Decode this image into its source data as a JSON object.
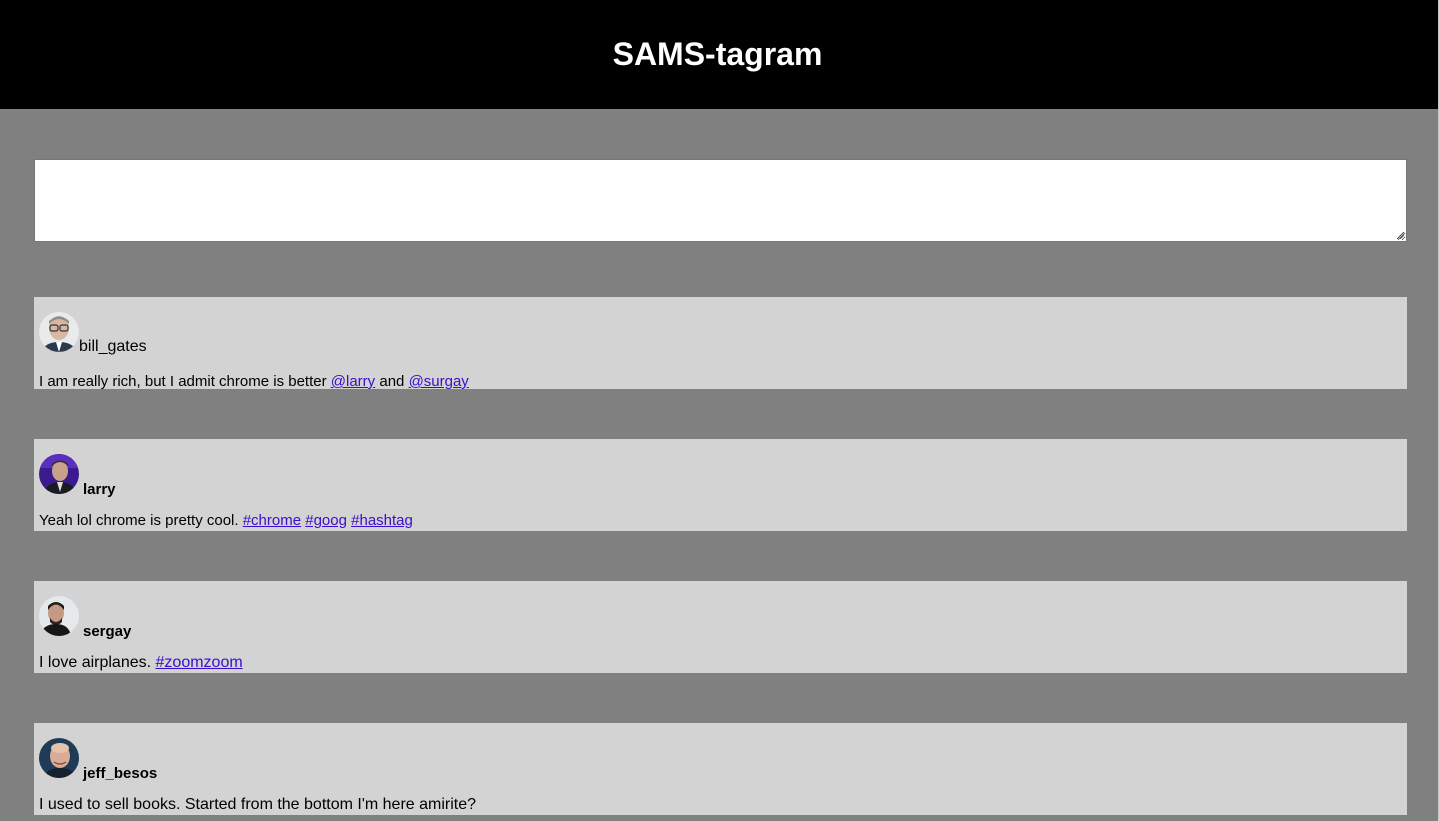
{
  "app": {
    "title": "SAMS-tagram"
  },
  "composer": {
    "value": "",
    "placeholder": ""
  },
  "posts": [
    {
      "username": "bill_gates",
      "segments": [
        {
          "text": "I am really rich, but I admit chrome is better "
        },
        {
          "link": "@larry"
        },
        {
          "text": " and "
        },
        {
          "link": "@surgay"
        }
      ],
      "avatar": "bill-gates-avatar"
    },
    {
      "username": "larry",
      "segments": [
        {
          "text": "Yeah lol chrome is pretty cool. "
        },
        {
          "link": "#chrome"
        },
        {
          "text": " "
        },
        {
          "link": "#goog"
        },
        {
          "text": " "
        },
        {
          "link": "#hashtag"
        }
      ],
      "avatar": "larry-avatar"
    },
    {
      "username": "sergay",
      "segments": [
        {
          "text": "I love airplanes. "
        },
        {
          "link": "#zoomzoom"
        }
      ],
      "avatar": "sergay-avatar"
    },
    {
      "username": "jeff_besos",
      "segments": [
        {
          "text": "I used to sell books. Started from the bottom I'm here amirite?"
        }
      ],
      "avatar": "jeff-besos-avatar"
    }
  ],
  "colors": {
    "header_bg": "#000000",
    "page_bg": "#808080",
    "post_bg": "#d3d3d3",
    "link": "#3b0dcc"
  }
}
